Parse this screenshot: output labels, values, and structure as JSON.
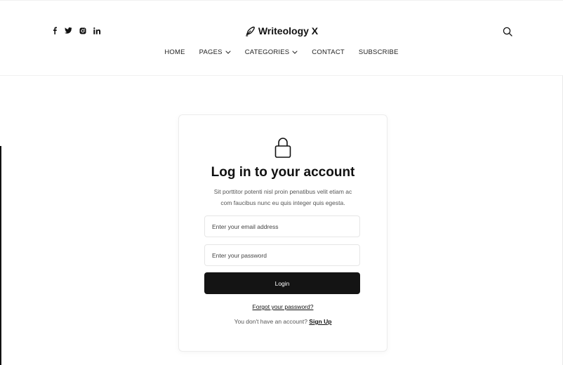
{
  "header": {
    "social": [
      "f",
      "t",
      "ig",
      "in"
    ],
    "brand": "Writeology X",
    "nav": [
      {
        "label": "HOME",
        "dropdown": false
      },
      {
        "label": "PAGES",
        "dropdown": true
      },
      {
        "label": "CATEGORIES",
        "dropdown": true
      },
      {
        "label": "CONTACT",
        "dropdown": false
      },
      {
        "label": "SUBSCRIBE",
        "dropdown": false
      }
    ]
  },
  "login": {
    "title": "Log in to your account",
    "subtitle_line1": "Sit porttitor potenti nisl proin penatibus velit etiam ac",
    "subtitle_line2": "com faucibus nunc eu quis integer quis egesta.",
    "email_placeholder": "Enter your email address",
    "password_placeholder": "Enter your password",
    "button_label": "Login",
    "forgot_link": "Forgot your password?",
    "signup_prompt": "You don't have an account?",
    "signup_link": "Sign Up"
  },
  "icons": {
    "social": [
      "facebook-icon",
      "twitter-icon",
      "instagram-icon",
      "linkedin-icon"
    ],
    "logo": "pen-icon",
    "search": "search-icon",
    "lock": "lock-icon"
  }
}
